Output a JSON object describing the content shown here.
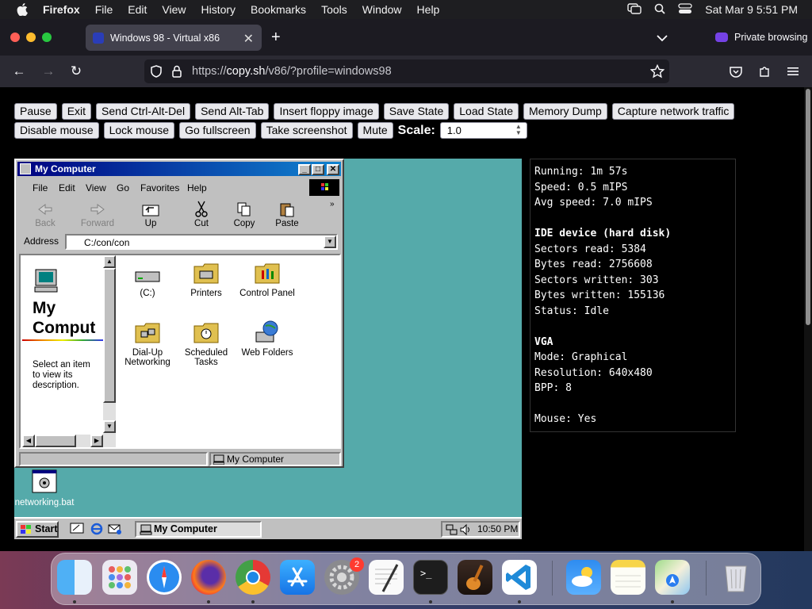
{
  "menubar": {
    "app": "Firefox",
    "menus": [
      "File",
      "Edit",
      "View",
      "History",
      "Bookmarks",
      "Tools",
      "Window",
      "Help"
    ],
    "datetime": "Sat Mar 9  5:51 PM"
  },
  "browser": {
    "tab_title": "Windows 98 - Virtual x86",
    "private_label": "Private browsing",
    "url_prefix": "https://",
    "url_host": "copy.sh",
    "url_path": "/v86/?profile=windows98"
  },
  "controls": {
    "row1": [
      "Pause",
      "Exit",
      "Send Ctrl-Alt-Del",
      "Send Alt-Tab",
      "Insert floppy image",
      "Save State",
      "Load State",
      "Memory Dump",
      "Capture network traffic"
    ],
    "row2": [
      "Disable mouse",
      "Lock mouse",
      "Go fullscreen",
      "Take screenshot",
      "Mute"
    ],
    "scale_label": "Scale:",
    "scale_value": "1.0"
  },
  "win98": {
    "window_title": "My Computer",
    "menu": [
      "File",
      "Edit",
      "View",
      "Go",
      "Favorites",
      "Help"
    ],
    "toolbar": {
      "back": "Back",
      "forward": "Forward",
      "up": "Up",
      "cut": "Cut",
      "copy": "Copy",
      "paste": "Paste"
    },
    "address_label": "Address",
    "address_value": "C:/con/con",
    "left_title_1": "My",
    "left_title_2": "Comput",
    "left_desc": "Select an item to view its description.",
    "icons": [
      "(C:)",
      "Printers",
      "Control Panel",
      "Dial-Up Networking",
      "Scheduled Tasks",
      "Web Folders"
    ],
    "status_text": "My Computer",
    "desktop_icon": "networking.bat",
    "start_label": "Start",
    "task_label": "My Computer",
    "clock": "10:50 PM"
  },
  "info": {
    "running": "Running: 1m 57s",
    "speed": "Speed: 0.5 mIPS",
    "avg_speed": "Avg speed: 7.0 mIPS",
    "ide_title": "IDE device (hard disk)",
    "sectors_read": "Sectors read: 5384",
    "bytes_read": "Bytes read: 2756608",
    "sectors_written": "Sectors written: 303",
    "bytes_written": "Bytes written: 155136",
    "status": "Status: Idle",
    "vga_title": "VGA",
    "mode": "Mode: Graphical",
    "resolution": "Resolution: 640x480",
    "bpp": "BPP: 8",
    "mouse": "Mouse: Yes"
  },
  "dock": {
    "apps": [
      "finder-icon",
      "launchpad-icon",
      "safari-icon",
      "firefox-icon",
      "chrome-icon",
      "app-store-icon",
      "system-settings-icon",
      "textedit-icon",
      "terminal-icon",
      "garageband-icon",
      "vscode-icon",
      "weather-icon",
      "notes-icon",
      "maps-icon",
      "trash-icon"
    ],
    "settings_badge": "2"
  }
}
